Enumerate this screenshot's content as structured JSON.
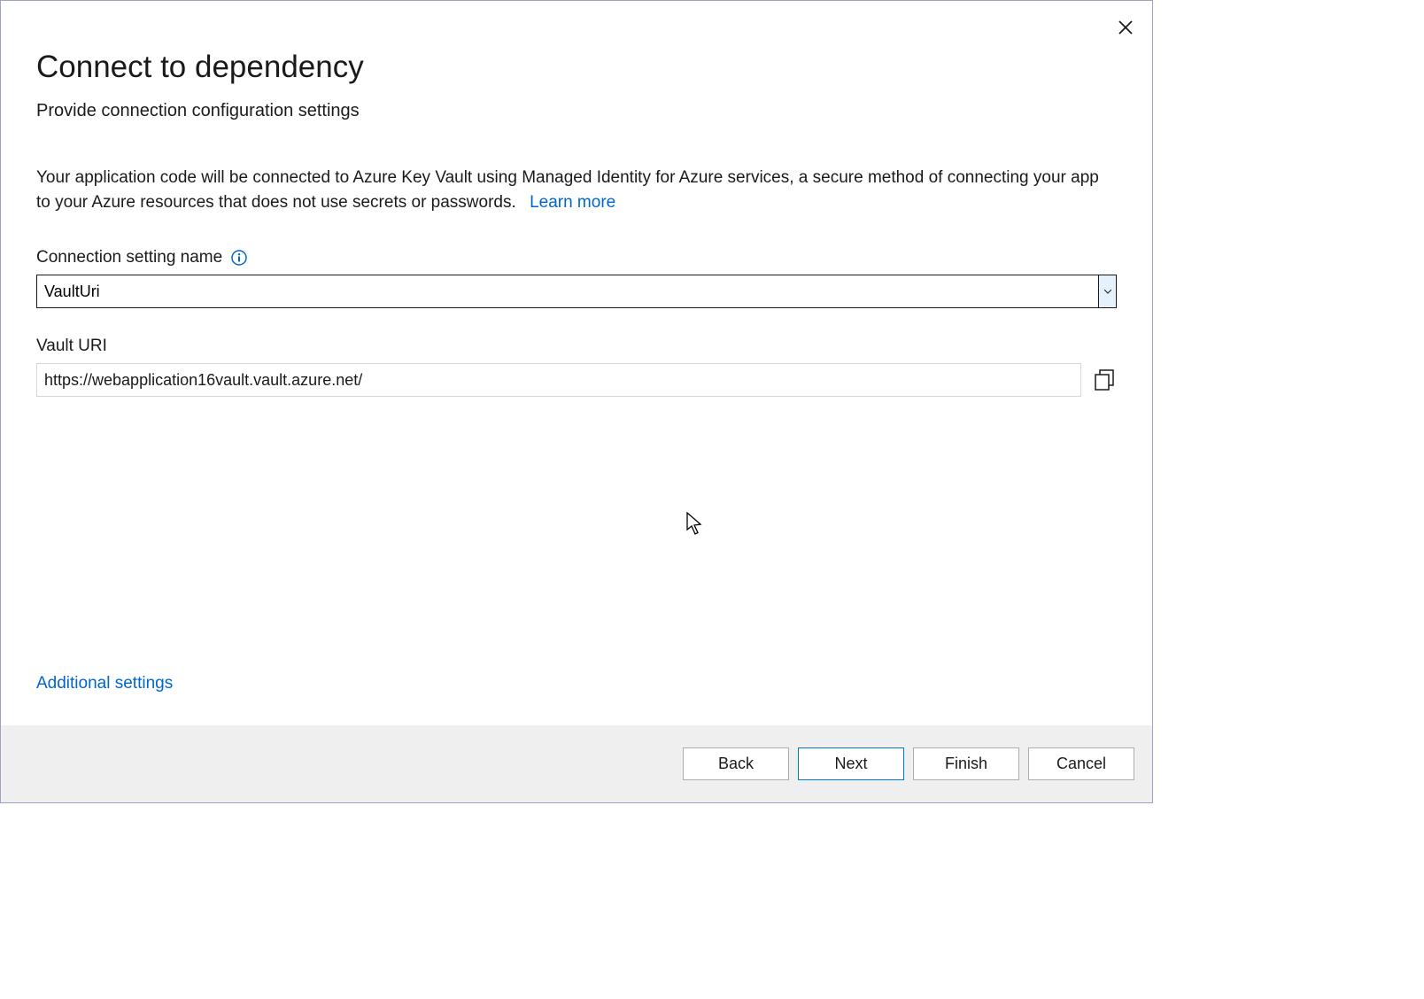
{
  "dialog": {
    "title": "Connect to dependency",
    "subtitle": "Provide connection configuration settings",
    "description": "Your application code will be connected to Azure Key Vault using Managed Identity for Azure services, a secure method of connecting your app to your Azure resources that does not use secrets or passwords.",
    "learn_more": "Learn more"
  },
  "fields": {
    "connection_name_label": "Connection setting name",
    "connection_name_value": "VaultUri",
    "vault_uri_label": "Vault URI",
    "vault_uri_value": "https://webapplication16vault.vault.azure.net/"
  },
  "links": {
    "additional_settings": "Additional settings"
  },
  "buttons": {
    "back": "Back",
    "next": "Next",
    "finish": "Finish",
    "cancel": "Cancel"
  }
}
